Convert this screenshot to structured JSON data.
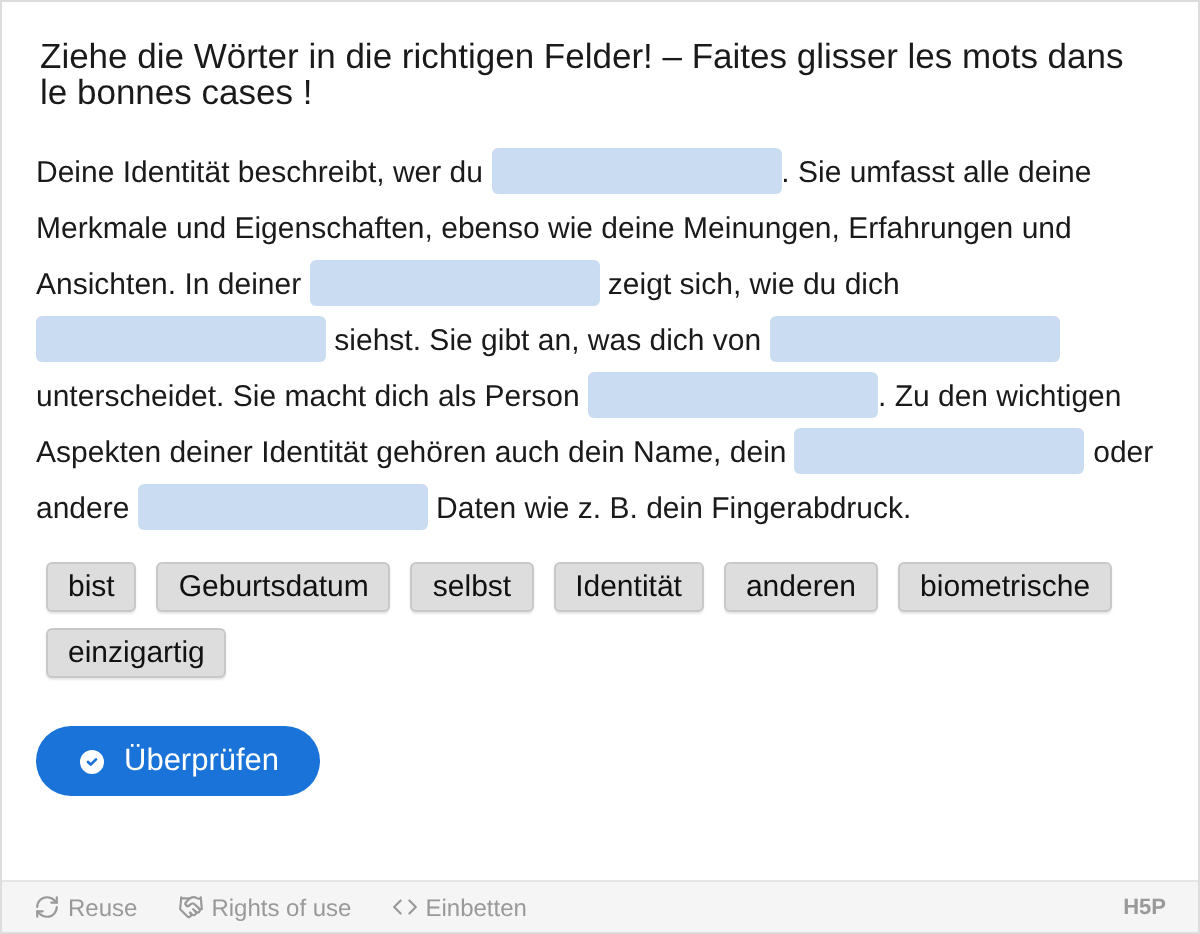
{
  "title": "Ziehe die Wörter in die richtigen Felder! – Faites glisser les mots dans le bonnes cases !",
  "text": [
    {
      "kind": "text",
      "value": "Deine Identität beschreibt, wer du "
    },
    {
      "kind": "blank"
    },
    {
      "kind": "text",
      "value": ". Sie umfasst alle deine Merkmale und Eigenschaften, ebenso wie deine Meinungen, Erfahrungen und Ansichten. In deiner "
    },
    {
      "kind": "blank"
    },
    {
      "kind": "text",
      "value": " zeigt sich, wie du dich "
    },
    {
      "kind": "blank"
    },
    {
      "kind": "text",
      "value": " siehst. Sie gibt an, was dich von "
    },
    {
      "kind": "blank"
    },
    {
      "kind": "text",
      "value": " unterscheidet. Sie macht dich als Person "
    },
    {
      "kind": "blank"
    },
    {
      "kind": "text",
      "value": ". Zu den wichtigen Aspekten deiner Identität gehören auch dein Name, dein "
    },
    {
      "kind": "blank"
    },
    {
      "kind": "text",
      "value": " oder andere "
    },
    {
      "kind": "blank"
    },
    {
      "kind": "text",
      "value": " Daten wie z. B. dein Fingerabdruck."
    }
  ],
  "words": [
    "bist",
    "Geburtsdatum",
    "selbst",
    "Identität",
    "anderen",
    "biometrische",
    "einzigartig"
  ],
  "check_button": "Überprüfen",
  "footer": {
    "links": [
      {
        "kind": "reuse",
        "label": "Reuse"
      },
      {
        "kind": "rights",
        "label": "Rights of use"
      },
      {
        "kind": "embed",
        "label": "Einbetten"
      }
    ],
    "logo": "H5P"
  }
}
